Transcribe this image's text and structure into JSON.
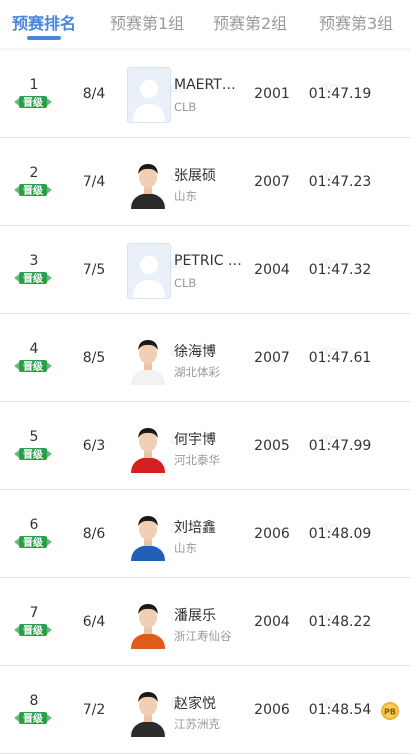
{
  "tabs": [
    {
      "label": "预赛排名",
      "active": true
    },
    {
      "label": "预赛第1组",
      "active": false
    },
    {
      "label": "预赛第2组",
      "active": false
    },
    {
      "label": "预赛第3组",
      "active": false
    }
  ],
  "badge_label": "晋级",
  "pb_label": "PB",
  "rows": [
    {
      "rank": "1",
      "lane": "8/4",
      "name": "MAERT…",
      "team": "CLB",
      "year": "2001",
      "time": "01:47.19",
      "avatar": "placeholder"
    },
    {
      "rank": "2",
      "lane": "7/4",
      "name": "张展硕",
      "team": "山东",
      "year": "2007",
      "time": "01:47.23",
      "avatar": "photo"
    },
    {
      "rank": "3",
      "lane": "7/5",
      "name": "PETRIC …",
      "team": "CLB",
      "year": "2004",
      "time": "01:47.32",
      "avatar": "placeholder"
    },
    {
      "rank": "4",
      "lane": "8/5",
      "name": "徐海博",
      "team": "湖北体彩",
      "year": "2007",
      "time": "01:47.61",
      "avatar": "photo"
    },
    {
      "rank": "5",
      "lane": "6/3",
      "name": "何宇博",
      "team": "河北泰华",
      "year": "2005",
      "time": "01:47.99",
      "avatar": "photo"
    },
    {
      "rank": "6",
      "lane": "8/6",
      "name": "刘培鑫",
      "team": "山东",
      "year": "2006",
      "time": "01:48.09",
      "avatar": "photo"
    },
    {
      "rank": "7",
      "lane": "6/4",
      "name": "潘展乐",
      "team": "浙江寿仙谷",
      "year": "2004",
      "time": "01:48.22",
      "avatar": "photo"
    },
    {
      "rank": "8",
      "lane": "7/2",
      "name": "赵家悦",
      "team": "江苏洲克",
      "year": "2006",
      "time": "01:48.54",
      "avatar": "photo",
      "pb": true
    }
  ],
  "colors": {
    "accent": "#4a86d9",
    "qualify_green": "#2aa04a",
    "pb_gold": "#f0b429"
  }
}
